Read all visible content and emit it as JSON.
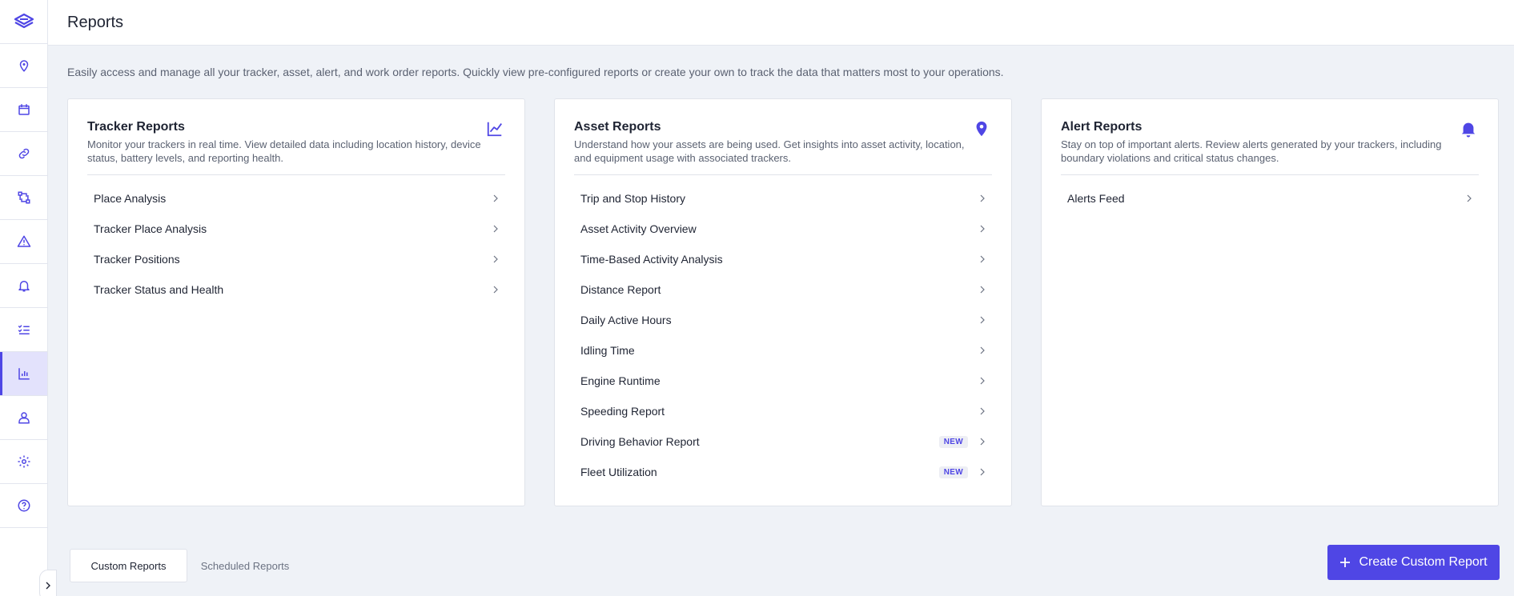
{
  "header": {
    "title": "Reports"
  },
  "description": "Easily access and manage all your tracker, asset, alert, and work order reports. Quickly view pre-configured reports or create your own to track the data that matters most to your operations.",
  "sidebar": {
    "items": [
      {
        "name": "map-pin-icon"
      },
      {
        "name": "calendar-icon"
      },
      {
        "name": "link-icon"
      },
      {
        "name": "route-icon"
      },
      {
        "name": "warning-icon"
      },
      {
        "name": "bell-icon"
      },
      {
        "name": "checklist-icon"
      },
      {
        "name": "bar-chart-icon",
        "active": true
      },
      {
        "name": "user-icon"
      },
      {
        "name": "gear-icon"
      },
      {
        "name": "help-icon"
      }
    ]
  },
  "cards": [
    {
      "title": "Tracker Reports",
      "description": "Monitor your trackers in real time. View detailed data including location history, device status, battery levels, and reporting health.",
      "icon": "line-chart-icon",
      "items": [
        {
          "label": "Place Analysis"
        },
        {
          "label": "Tracker Place Analysis"
        },
        {
          "label": "Tracker Positions"
        },
        {
          "label": "Tracker Status and Health"
        }
      ]
    },
    {
      "title": "Asset Reports",
      "description": "Understand how your assets are being used. Get insights into asset activity, location, and equipment usage with associated trackers.",
      "icon": "location-pin-icon",
      "items": [
        {
          "label": "Trip and Stop History"
        },
        {
          "label": "Asset Activity Overview"
        },
        {
          "label": "Time-Based Activity Analysis"
        },
        {
          "label": "Distance Report"
        },
        {
          "label": "Daily Active Hours"
        },
        {
          "label": "Idling Time"
        },
        {
          "label": "Engine Runtime"
        },
        {
          "label": "Speeding Report"
        },
        {
          "label": "Driving Behavior Report",
          "badge": "NEW"
        },
        {
          "label": "Fleet Utilization",
          "badge": "NEW"
        }
      ]
    },
    {
      "title": "Alert Reports",
      "description": "Stay on top of important alerts. Review alerts generated by your trackers, including boundary violations and critical status changes.",
      "icon": "bell-icon",
      "items": [
        {
          "label": "Alerts Feed"
        }
      ]
    }
  ],
  "tabs": {
    "custom": "Custom Reports",
    "scheduled": "Scheduled Reports"
  },
  "create_button": "Create Custom Report",
  "colors": {
    "accent": "#4f46e5",
    "background": "#eff2f7"
  }
}
